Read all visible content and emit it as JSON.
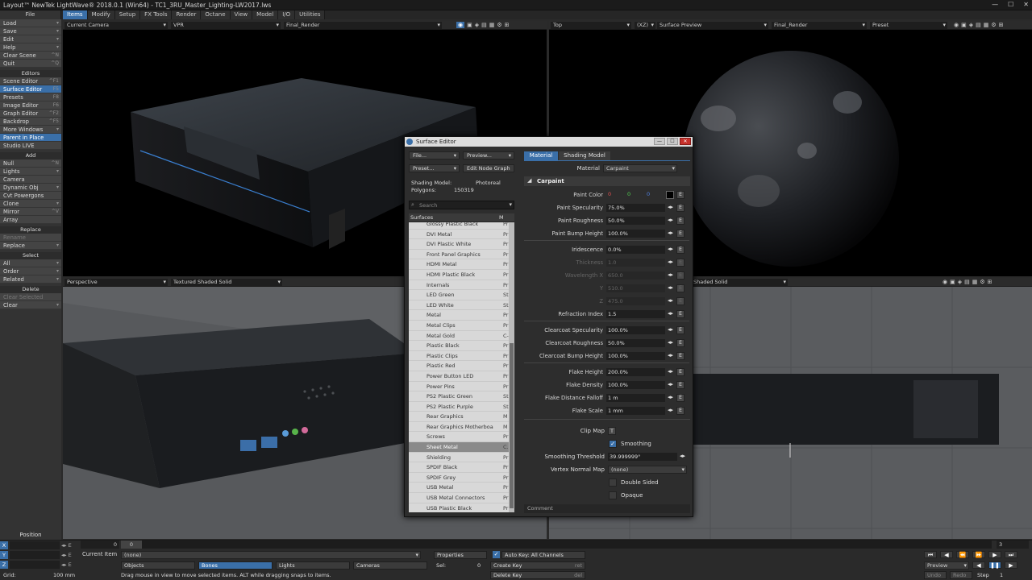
{
  "title_bar": {
    "title": "Layout™ NewTek LightWave® 2018.0.1 (Win64) - TC1_3RU_Master_Lighting-LW2017.lws",
    "min": "—",
    "max": "☐",
    "close": "✕"
  },
  "menu": {
    "file": "File",
    "tabs": [
      "Items",
      "Modify",
      "Setup",
      "FX Tools",
      "Render",
      "Octane",
      "View",
      "Model",
      "I/O",
      "Utilities"
    ]
  },
  "left": {
    "top": [
      {
        "label": "Load",
        "shortcut": "▾"
      },
      {
        "label": "Save",
        "shortcut": "▾"
      },
      {
        "label": "Edit",
        "shortcut": "▾"
      },
      {
        "label": "Help",
        "shortcut": "▾"
      },
      {
        "label": "Clear Scene",
        "shortcut": "^N"
      },
      {
        "label": "Quit",
        "shortcut": "^Q"
      }
    ],
    "editors_header": "Editors",
    "editors": [
      {
        "label": "Scene Editor",
        "shortcut": "^F1"
      },
      {
        "label": "Surface Editor",
        "shortcut": "F5"
      },
      {
        "label": "Presets",
        "shortcut": "F8"
      },
      {
        "label": "Image Editor",
        "shortcut": "F6"
      },
      {
        "label": "Graph Editor",
        "shortcut": "^F2"
      },
      {
        "label": "Backdrop",
        "shortcut": "^F5"
      },
      {
        "label": "More Windows",
        "shortcut": "▾"
      },
      {
        "label": "Parent in Place",
        "shortcut": ""
      },
      {
        "label": "Studio LIVE",
        "shortcut": ""
      }
    ],
    "add_header": "Add",
    "add": [
      {
        "label": "Null",
        "shortcut": "^N"
      },
      {
        "label": "Lights",
        "shortcut": "▾"
      },
      {
        "label": "Camera",
        "shortcut": ""
      },
      {
        "label": "Dynamic Obj",
        "shortcut": "▾"
      },
      {
        "label": "Cvt Powergons",
        "shortcut": ""
      },
      {
        "label": "Clone",
        "shortcut": "▾"
      },
      {
        "label": "Mirror",
        "shortcut": "^V"
      },
      {
        "label": "Array",
        "shortcut": ""
      }
    ],
    "replace_header": "Replace",
    "replace": [
      {
        "label": "Rename",
        "shortcut": ""
      },
      {
        "label": "Replace",
        "shortcut": "▾"
      }
    ],
    "select_header": "Select",
    "select": [
      {
        "label": "All",
        "shortcut": "▾"
      },
      {
        "label": "Order",
        "shortcut": "▾"
      },
      {
        "label": "Related",
        "shortcut": "▾"
      }
    ],
    "delete_header": "Delete",
    "delete": [
      {
        "label": "Clear Selected",
        "shortcut": ""
      },
      {
        "label": "Clear",
        "shortcut": "▾"
      }
    ]
  },
  "viewports": {
    "tl": {
      "view": "Current Camera",
      "mode": "VPR",
      "render": "Final_Render"
    },
    "tr": {
      "view": "Top",
      "axis": "(XZ)",
      "mode": "Surface Preview",
      "render": "Final_Render",
      "preset": "Preset"
    },
    "bl": {
      "view": "Perspective",
      "mode": "Textured Shaded Solid"
    },
    "br": {
      "mode": "Shaded Solid"
    }
  },
  "surface_editor": {
    "title": "Surface Editor",
    "file": "File...",
    "preview": "Preview...",
    "preset": "Preset...",
    "edit_node_graph": "Edit Node Graph",
    "shading_model_label": "Shading Model:",
    "shading_model_value": "Photoreal",
    "polygons_label": "Polygons:",
    "polygons_value": "150319",
    "search_placeholder": "Search",
    "col_surfaces": "Surfaces",
    "col_m": "M",
    "surfaces": [
      {
        "name": "Glossy Plastic Black",
        "m": "Pr"
      },
      {
        "name": "DVI Metal",
        "m": "Pr"
      },
      {
        "name": "DVI Plastic White",
        "m": "Pr"
      },
      {
        "name": "Front Panel Graphics",
        "m": "Pr"
      },
      {
        "name": "HDMI Metal",
        "m": "Pr"
      },
      {
        "name": "HDMI Plastic Black",
        "m": "Pr"
      },
      {
        "name": "Internals",
        "m": "Pr"
      },
      {
        "name": "LED Green",
        "m": "St"
      },
      {
        "name": "LED White",
        "m": "St"
      },
      {
        "name": "Metal",
        "m": "Pr"
      },
      {
        "name": "Metal Clips",
        "m": "Pr"
      },
      {
        "name": "Metal Gold",
        "m": "C-"
      },
      {
        "name": "Plastic Black",
        "m": "Pr"
      },
      {
        "name": "Plastic Clips",
        "m": "Pr"
      },
      {
        "name": "Plastic Red",
        "m": "Pr"
      },
      {
        "name": "Power Button LED",
        "m": "Pr"
      },
      {
        "name": "Power Pins",
        "m": "Pr"
      },
      {
        "name": "PS2 Plastic Green",
        "m": "St"
      },
      {
        "name": "PS2 Plastic Purple",
        "m": "St"
      },
      {
        "name": "Rear Graphics",
        "m": "M"
      },
      {
        "name": "Rear Graphics Motherboa",
        "m": "M"
      },
      {
        "name": "Screws",
        "m": "Pr"
      },
      {
        "name": "Sheet Metal",
        "m": "C."
      },
      {
        "name": "Shielding",
        "m": "Pr"
      },
      {
        "name": "SPDIF Black",
        "m": "Pr"
      },
      {
        "name": "SPDIF Grey",
        "m": "Pr"
      },
      {
        "name": "USB Metal",
        "m": "Pr"
      },
      {
        "name": "USB Metal Connectors",
        "m": "Pr"
      },
      {
        "name": "USB Plastic Black",
        "m": "Pr"
      }
    ],
    "tab_material": "Material",
    "tab_shading": "Shading Model",
    "material_label": "Material",
    "material_value": "Carpaint",
    "group_label": "Carpaint",
    "paint_color_label": "Paint Color",
    "paint_color": [
      "0",
      "0",
      "0"
    ],
    "props1": [
      {
        "label": "Paint Specularity",
        "value": "75.0%"
      },
      {
        "label": "Paint Roughness",
        "value": "50.0%"
      },
      {
        "label": "Paint Bump Height",
        "value": "100.0%"
      }
    ],
    "props2": [
      {
        "label": "Iridescence",
        "value": "0.0%",
        "dim": false
      },
      {
        "label": "Thickness",
        "value": "1.0",
        "dim": true
      },
      {
        "label": "Wavelength X",
        "value": "650.0",
        "dim": true
      },
      {
        "label": "Y",
        "value": "510.0",
        "dim": true
      },
      {
        "label": "Z",
        "value": "475.0",
        "dim": true
      },
      {
        "label": "Refraction Index",
        "value": "1.5",
        "dim": false
      }
    ],
    "props3": [
      {
        "label": "Clearcoat Specularity",
        "value": "100.0%"
      },
      {
        "label": "Clearcoat Roughness",
        "value": "50.0%"
      },
      {
        "label": "Clearcoat Bump Height",
        "value": "100.0%"
      }
    ],
    "props4": [
      {
        "label": "Flake Height",
        "value": "200.0%"
      },
      {
        "label": "Flake Density",
        "value": "100.0%"
      },
      {
        "label": "Flake Distance Falloff",
        "value": "1 m"
      },
      {
        "label": "Flake Scale",
        "value": "1 mm"
      }
    ],
    "clip_map_label": "Clip Map",
    "clip_map_btn": "T",
    "smoothing_label": "Smoothing",
    "smoothing_threshold_label": "Smoothing Threshold",
    "smoothing_threshold_value": "39.999999°",
    "vertex_normal_label": "Vertex Normal Map",
    "vertex_normal_value": "(none)",
    "double_sided_label": "Double Sided",
    "opaque_label": "Opaque",
    "comment_label": "Comment",
    "env": "◂▸",
    "e": "E"
  },
  "bottom": {
    "position_label": "Position",
    "axes": [
      "X",
      "Y",
      "Z"
    ],
    "grid_label": "Grid:",
    "grid_value": "100 mm",
    "frame_start": "0",
    "frame_end": "3",
    "frame_current": "0",
    "current_item_label": "Current Item",
    "current_item_value": "(none)",
    "objects": "Objects",
    "bones": "Bones",
    "lights": "Lights",
    "cameras": "Cameras",
    "properties": "Properties",
    "sel_label": "Sel:",
    "sel_value": "0",
    "auto_key": "Auto Key: All Channels",
    "create_key": "Create Key",
    "delete_key": "Delete Key",
    "create_key_sc": "ret",
    "delete_key_sc": "del",
    "status": "Drag mouse in view to move selected items. ALT while dragging snaps to items.",
    "preview": "Preview",
    "undo": "Undo",
    "redo": "Redo",
    "step_label": "Step",
    "step_value": "1"
  }
}
